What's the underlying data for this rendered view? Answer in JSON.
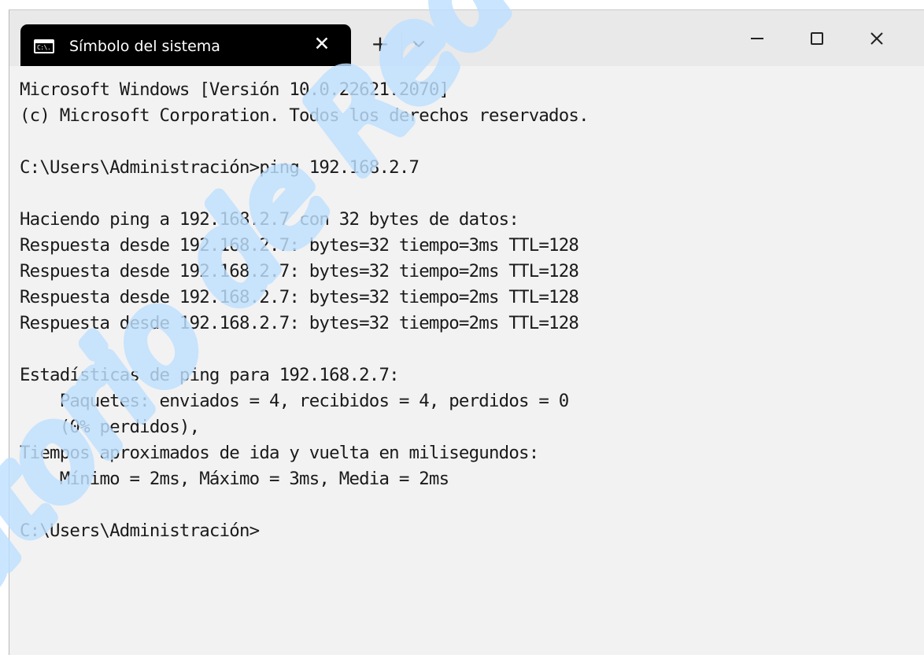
{
  "window": {
    "tab_title": "Símbolo del sistema",
    "tab_icon_text": "C:\\.",
    "tab_close_symbol": "✕",
    "new_tab_symbol": "+"
  },
  "terminal": {
    "lines": [
      "Microsoft Windows [Versión 10.0.22621.2070]",
      "(c) Microsoft Corporation. Todos los derechos reservados.",
      "",
      "C:\\Users\\Administración>ping 192.168.2.7",
      "",
      "Haciendo ping a 192.168.2.7 con 32 bytes de datos:",
      "Respuesta desde 192.168.2.7: bytes=32 tiempo=3ms TTL=128",
      "Respuesta desde 192.168.2.7: bytes=32 tiempo=2ms TTL=128",
      "Respuesta desde 192.168.2.7: bytes=32 tiempo=2ms TTL=128",
      "Respuesta desde 192.168.2.7: bytes=32 tiempo=2ms TTL=128",
      "",
      "Estadísticas de ping para 192.168.2.7:",
      "    Paquetes: enviados = 4, recibidos = 4, perdidos = 0",
      "    (0% perdidos),",
      "Tiempos aproximados de ida y vuelta en milisegundos:",
      "    Mínimo = 2ms, Máximo = 3ms, Media = 2ms",
      "",
      "C:\\Users\\Administración>"
    ]
  },
  "watermark": {
    "color": "#bfe0ff"
  },
  "colors": {
    "titlebar_bg": "#e9e9e9",
    "tab_bg": "#000000",
    "terminal_bg": "#f2f2f2",
    "text": "#1a1a1a"
  }
}
